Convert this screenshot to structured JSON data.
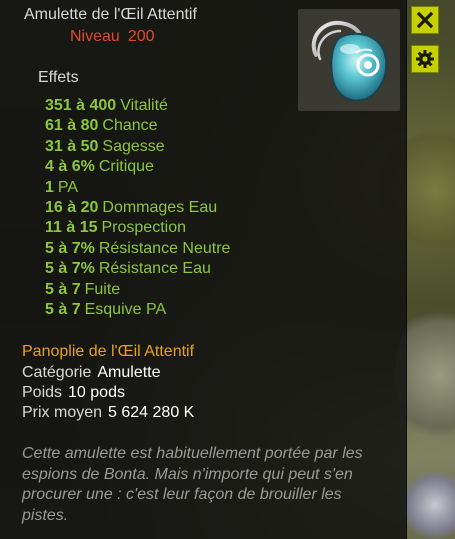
{
  "item": {
    "name": "Amulette de l'Œil Attentif",
    "level_label": "Niveau",
    "level_value": "200",
    "icon": "amulet-eye-icon"
  },
  "effects_heading": "Effets",
  "effects": [
    {
      "value": "351 à 400",
      "label": "Vitalité"
    },
    {
      "value": "61 à 80",
      "label": "Chance"
    },
    {
      "value": "31 à 50",
      "label": "Sagesse"
    },
    {
      "value": "4 à 6%",
      "label": "Critique"
    },
    {
      "value": "1",
      "label": "PA"
    },
    {
      "value": "16 à 20",
      "label": "Dommages Eau"
    },
    {
      "value": "11 à 15",
      "label": "Prospection"
    },
    {
      "value": "5 à 7%",
      "label": "Résistance Neutre"
    },
    {
      "value": "5 à 7%",
      "label": "Résistance Eau"
    },
    {
      "value": "5 à 7",
      "label": "Fuite"
    },
    {
      "value": "5 à 7",
      "label": "Esquive PA"
    }
  ],
  "set_name": "Panoplie de l'Œil Attentif",
  "properties": {
    "category_label": "Catégorie",
    "category_value": "Amulette",
    "weight_label": "Poids",
    "weight_value": "10 pods",
    "price_label": "Prix moyen",
    "price_value": "5 624 280 K"
  },
  "description": "Cette amulette est habituellement portée par les espions de Bonta. Mais n'importe qui peut s'en procurer une : c'est leur façon de brouiller les pistes.",
  "buttons": {
    "close_icon": "close-icon",
    "settings_icon": "gear-icon"
  },
  "colors": {
    "effect_green": "#8cc63f",
    "level_red": "#e04a2c",
    "set_orange": "#e8a317",
    "button_yellow": "#c6d000",
    "description_gray": "#9a9a9a"
  }
}
